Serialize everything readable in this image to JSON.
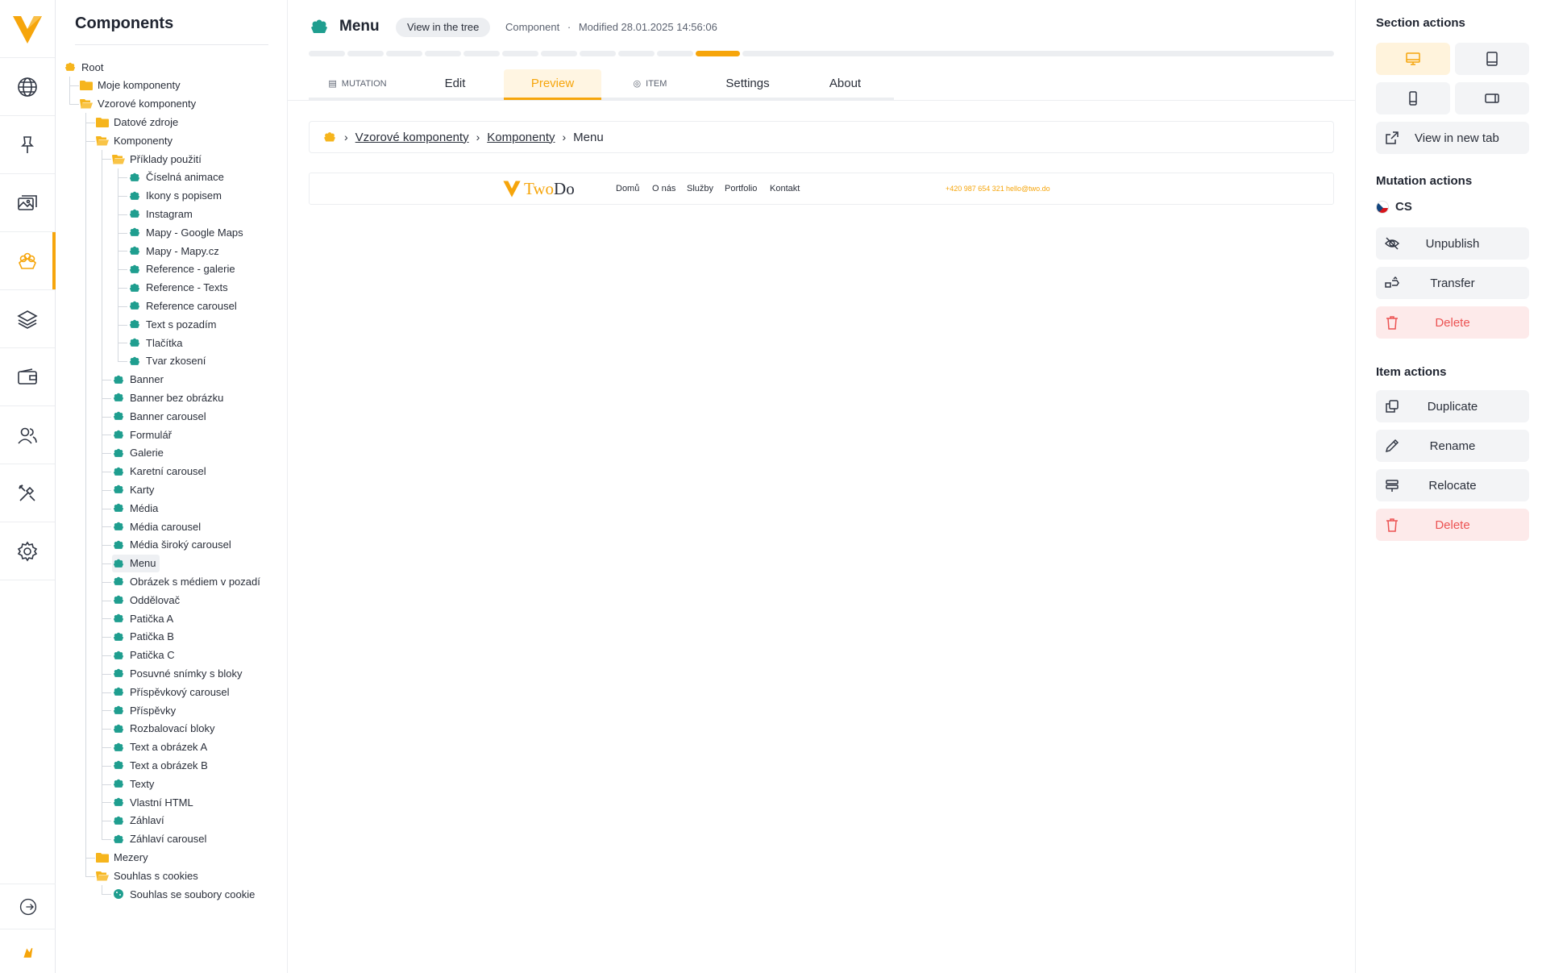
{
  "colors": {
    "accent": "#f6a50b",
    "teal": "#1f9e8f",
    "danger": "#ec5353",
    "folder": "#f6b51d"
  },
  "rail": {
    "items": [
      {
        "name": "globe-icon"
      },
      {
        "name": "pin-icon"
      },
      {
        "name": "images-icon"
      },
      {
        "name": "components-icon"
      },
      {
        "name": "layers-icon"
      },
      {
        "name": "wallet-icon"
      },
      {
        "name": "users-icon"
      },
      {
        "name": "tools-icon"
      },
      {
        "name": "gear-icon"
      }
    ],
    "active_index": 3
  },
  "tree": {
    "title": "Components",
    "nodes": [
      {
        "label": "Root",
        "depth": 0,
        "icon": "root"
      },
      {
        "label": "Moje komponenty",
        "depth": 1,
        "icon": "folder"
      },
      {
        "label": "Vzorové komponenty",
        "depth": 1,
        "icon": "folder-open"
      },
      {
        "label": "Datové zdroje",
        "depth": 2,
        "icon": "folder"
      },
      {
        "label": "Komponenty",
        "depth": 2,
        "icon": "folder-open"
      },
      {
        "label": "Příklady použití",
        "depth": 3,
        "icon": "folder-open"
      },
      {
        "label": "Číselná animace",
        "depth": 4,
        "icon": "component"
      },
      {
        "label": "Ikony s popisem",
        "depth": 4,
        "icon": "component"
      },
      {
        "label": "Instagram",
        "depth": 4,
        "icon": "component"
      },
      {
        "label": "Mapy - Google Maps",
        "depth": 4,
        "icon": "component"
      },
      {
        "label": "Mapy - Mapy.cz",
        "depth": 4,
        "icon": "component"
      },
      {
        "label": "Reference - galerie",
        "depth": 4,
        "icon": "component"
      },
      {
        "label": "Reference - Texts",
        "depth": 4,
        "icon": "component"
      },
      {
        "label": "Reference carousel",
        "depth": 4,
        "icon": "component"
      },
      {
        "label": "Text s pozadím",
        "depth": 4,
        "icon": "component"
      },
      {
        "label": "Tlačítka",
        "depth": 4,
        "icon": "component"
      },
      {
        "label": "Tvar zkosení",
        "depth": 4,
        "icon": "component"
      },
      {
        "label": "Banner",
        "depth": 3,
        "icon": "component"
      },
      {
        "label": "Banner bez obrázku",
        "depth": 3,
        "icon": "component"
      },
      {
        "label": "Banner carousel",
        "depth": 3,
        "icon": "component"
      },
      {
        "label": "Formulář",
        "depth": 3,
        "icon": "component"
      },
      {
        "label": "Galerie",
        "depth": 3,
        "icon": "component"
      },
      {
        "label": "Karetní carousel",
        "depth": 3,
        "icon": "component"
      },
      {
        "label": "Karty",
        "depth": 3,
        "icon": "component"
      },
      {
        "label": "Média",
        "depth": 3,
        "icon": "component"
      },
      {
        "label": "Média carousel",
        "depth": 3,
        "icon": "component"
      },
      {
        "label": "Média široký carousel",
        "depth": 3,
        "icon": "component"
      },
      {
        "label": "Menu",
        "depth": 3,
        "icon": "component",
        "selected": true
      },
      {
        "label": "Obrázek s médiem v pozadí",
        "depth": 3,
        "icon": "component"
      },
      {
        "label": "Oddělovač",
        "depth": 3,
        "icon": "component"
      },
      {
        "label": "Patička A",
        "depth": 3,
        "icon": "component"
      },
      {
        "label": "Patička B",
        "depth": 3,
        "icon": "component"
      },
      {
        "label": "Patička C",
        "depth": 3,
        "icon": "component"
      },
      {
        "label": "Posuvné snímky s bloky",
        "depth": 3,
        "icon": "component"
      },
      {
        "label": "Příspěvkový carousel",
        "depth": 3,
        "icon": "component"
      },
      {
        "label": "Příspěvky",
        "depth": 3,
        "icon": "component"
      },
      {
        "label": "Rozbalovací bloky",
        "depth": 3,
        "icon": "component"
      },
      {
        "label": "Text a obrázek A",
        "depth": 3,
        "icon": "component"
      },
      {
        "label": "Text a obrázek B",
        "depth": 3,
        "icon": "component"
      },
      {
        "label": "Texty",
        "depth": 3,
        "icon": "component"
      },
      {
        "label": "Vlastní HTML",
        "depth": 3,
        "icon": "component"
      },
      {
        "label": "Záhlaví",
        "depth": 3,
        "icon": "component"
      },
      {
        "label": "Záhlaví carousel",
        "depth": 3,
        "icon": "component"
      },
      {
        "label": "Mezery",
        "depth": 2,
        "icon": "folder"
      },
      {
        "label": "Souhlas s cookies",
        "depth": 2,
        "icon": "folder-open"
      },
      {
        "label": "Souhlas se soubory cookie",
        "depth": 3,
        "icon": "cookie"
      }
    ]
  },
  "header": {
    "title": "Menu",
    "view_in_tree": "View in the tree",
    "type": "Component",
    "dot": "·",
    "modified": "Modified 28.01.2025 14:56:06",
    "progress_segments": 11,
    "progress_active": 10
  },
  "tabs": [
    {
      "label": "MUTATION",
      "icon": "ticket-icon",
      "small": true
    },
    {
      "label": "Edit"
    },
    {
      "label": "Preview",
      "active": true
    },
    {
      "label": "ITEM",
      "icon": "item-icon",
      "small": true
    },
    {
      "label": "Settings"
    },
    {
      "label": "About"
    }
  ],
  "breadcrumb": {
    "items": [
      "Vzorové komponenty",
      "Komponenty"
    ],
    "current": "Menu"
  },
  "preview": {
    "logo_two": "Two",
    "logo_do": "Do",
    "nav": [
      "Domů",
      "O nás",
      "Služby",
      "Portfolio",
      "Kontakt"
    ],
    "phone": "+420 987 654 321",
    "email": "hello@two.do"
  },
  "actions": {
    "section_title": "Section actions",
    "view_new_tab": "View in new tab",
    "mutation_title": "Mutation actions",
    "lang": "CS",
    "unpublish": "Unpublish",
    "transfer": "Transfer",
    "delete": "Delete",
    "item_title": "Item actions",
    "duplicate": "Duplicate",
    "rename": "Rename",
    "relocate": "Relocate",
    "item_delete": "Delete"
  }
}
